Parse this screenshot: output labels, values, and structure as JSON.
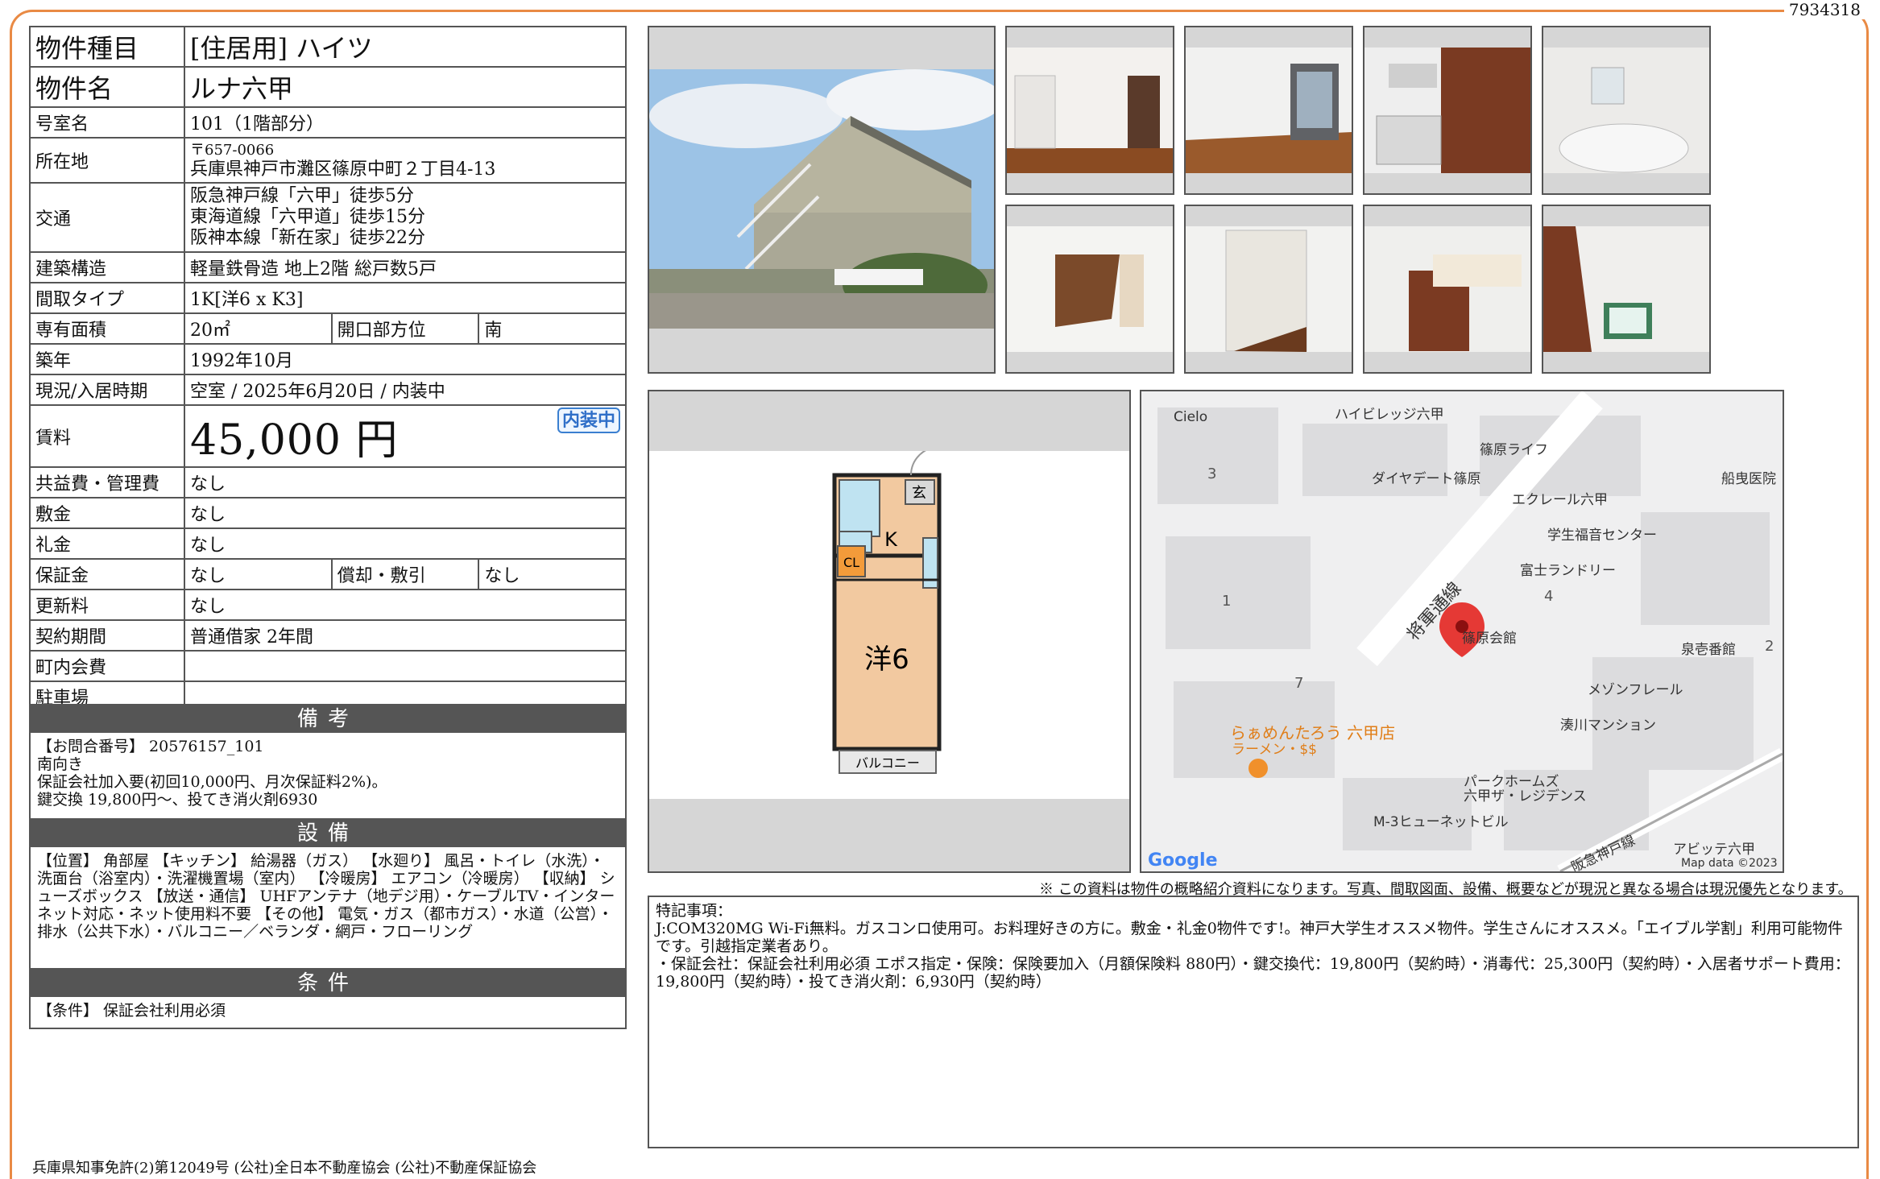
{
  "doc_id": "7934318",
  "property": {
    "type_label": "物件種目",
    "type_value": "[住居用] ハイツ",
    "name_label": "物件名",
    "name_value": "ルナ六甲",
    "room_label": "号室名",
    "room_value": "101（1階部分）",
    "address_label": "所在地",
    "postal": "〒657-0066",
    "address": "兵庫県神戸市灘区篠原中町２丁目4-13",
    "access_label": "交通",
    "access": [
      "阪急神戸線「六甲」徒歩5分",
      "東海道線「六甲道」徒歩15分",
      "阪神本線「新在家」徒歩22分"
    ],
    "structure_label": "建築構造",
    "structure_value": "軽量鉄骨造 地上2階 総戸数5戸",
    "layout_label": "間取タイプ",
    "layout_value": "1K[洋6 x K3]",
    "area_label": "専有面積",
    "area_value": "20㎡",
    "direction_label": "開口部方位",
    "direction_value": "南",
    "built_label": "築年",
    "built_value": "1992年10月",
    "status_label": "現況/入居時期",
    "status_value": "空室 / 2025年6月20日 / 内装中",
    "rent_label": "賃料",
    "rent_value": "45,000 円",
    "rent_badge": "内装中",
    "common_label": "共益費・管理費",
    "common_value": "なし",
    "deposit_label": "敷金",
    "deposit_value": "なし",
    "key_money_label": "礼金",
    "key_money_value": "なし",
    "guarantee_label": "保証金",
    "guarantee_value": "なし",
    "amort_label": "償却・敷引",
    "amort_value": "なし",
    "renewal_label": "更新料",
    "renewal_value": "なし",
    "contract_label": "契約期間",
    "contract_value": "普通借家 2年間",
    "town_fee_label": "町内会費",
    "town_fee_value": "",
    "parking_label": "駐車場",
    "parking_value": ""
  },
  "notes": {
    "title": "備考",
    "lines": [
      "【お問合番号】 20576157_101",
      "南向き",
      "保証会社加入要(初回10,000円、月次保証料2%)。",
      "鍵交換 19,800円～、投てき消火剤6930"
    ]
  },
  "equipment": {
    "title": "設備",
    "text": "【位置】 角部屋 【キッチン】 給湯器（ガス） 【水廻り】 風呂・トイレ（水洗）・洗面台（浴室内）・洗濯機置場（室内） 【冷暖房】 エアコン（冷暖房） 【収納】 シューズボックス 【放送・通信】 UHFアンテナ（地デジ用）・ケーブルTV・インターネット対応・ネット使用料不要 【その他】 電気・ガス（都市ガス）・水道（公営）・排水（公共下水）・バルコニー／ベランダ・網戸・フローリング"
  },
  "conditions": {
    "title": "条件",
    "text": "【条件】 保証会社利用必須"
  },
  "floor_plan": {
    "room_label": "洋6",
    "kitchen_label": "K",
    "closet_label": "CL",
    "entrance_label": "玄",
    "balcony_label": "バルコニー"
  },
  "map": {
    "labels": [
      "Cielo",
      "ハイビレッジ六甲",
      "篠原ライフ",
      "ダイヤデート篠原",
      "船曳医院",
      "エクレール六甲",
      "学生福音センター",
      "富士ランドリー",
      "篠原会館",
      "泉壱番館",
      "メゾンフレール",
      "湊川マンション",
      "らぁめんたろう 六甲店",
      "ラーメン・$$",
      "パークホームズ",
      "六甲ザ・レジデンス",
      "M-3ヒューネットビル",
      "アビッテ六甲",
      "将軍通線",
      "阪急神戸線"
    ],
    "numbers": [
      "3",
      "1",
      "4",
      "7",
      "2"
    ],
    "logo": "Google",
    "attribution": "Map data ©2023"
  },
  "notice": "※ この資料は物件の概略紹介資料になります。写真、間取図面、設備、概要などが現況と異なる場合は現況優先となります。",
  "remarks": {
    "title": "特記事項：",
    "lines": [
      "J:COM320MG Wi-Fi無料。ガスコンロ使用可。お料理好きの方に。敷金・礼金0物件です!。神戸大学生オススメ物件。学生さんにオススメ。「エイブル学割」利用可能物件です。引越指定業者あり。",
      "・保証会社：保証会社利用必須 エポス指定・保険：保険要加入（月額保険料 880円）・鍵交換代：19,800円（契約時）・消毒代：25,300円（契約時）・入居者サポート費用：19,800円（契約時）・投てき消火剤：6,930円（契約時）"
    ]
  },
  "footer": "兵庫県知事免許(2)第12049号 (公社)全日本不動産協会 (公社)不動産保証協会"
}
